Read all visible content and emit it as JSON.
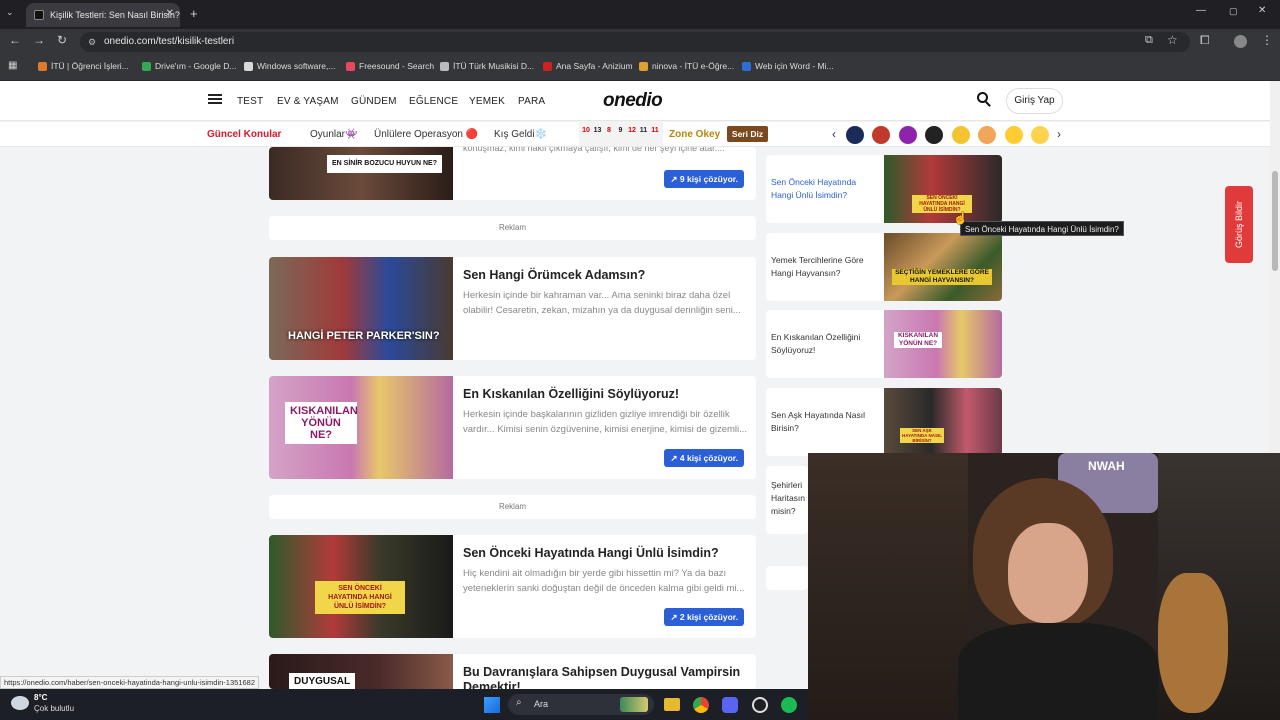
{
  "browser": {
    "tab_title": "Kişilik Testleri: Sen Nasıl Birisin?",
    "tab_close": "✕",
    "new_tab": "+",
    "url": "onedio.com/test/kisilik-testleri",
    "bookmarks": [
      {
        "label": "İTÜ | Öğrenci İşleri...",
        "color": "#e07a2a"
      },
      {
        "label": "Drive'ım - Google D...",
        "color": "#34a853"
      },
      {
        "label": "Windows software,...",
        "color": "#d9d9d9"
      },
      {
        "label": "Freesound - Search",
        "color": "#e8475f"
      },
      {
        "label": "İTÜ Türk Musikisi D...",
        "color": "#bbbbbb"
      },
      {
        "label": "Ana Sayfa - Anizium",
        "color": "#cc2222"
      },
      {
        "label": "ninova - İTÜ e-Öğre...",
        "color": "#e0a030"
      },
      {
        "label": "Web için Word - Mi...",
        "color": "#2b6fd6"
      }
    ]
  },
  "header": {
    "nav": [
      "TEST",
      "EV & YAŞAM",
      "GÜNDEM",
      "EĞLENCE",
      "YEMEK",
      "PARA"
    ],
    "logo": "onedio",
    "login": "Giriş Yap"
  },
  "subnav": {
    "current": "Güncel Konular",
    "items": [
      "Oyunlar👾",
      "Ünlülere Operasyon 🔴",
      "Kış Geldi❄️"
    ],
    "calendar": [
      "10",
      "13",
      "8",
      "9",
      "12",
      "11",
      "11"
    ],
    "zone": "Zone Okey",
    "serial": "Seri Diz"
  },
  "main": {
    "top_partial": {
      "desc": "konuşmaz, kimi haklı çıkmaya çalışır, kimi de her şeyi içine atar....",
      "solve": "9 kişi çözüyor.",
      "banner": "EN SİNİR BOZUCU HUYUN NE?"
    },
    "ad_label": "Reklam",
    "cards": [
      {
        "title": "Sen Hangi Örümcek Adamsın?",
        "desc": "Herkesin içinde bir kahraman var... Ama seninki biraz daha özel olabilir! Cesaretin, zekan, mizahın ya da duygusal derinliğin seni...",
        "banner": "HANGİ PETER PARKER'SIN?"
      },
      {
        "title": "En Kıskanılan Özelliğini Söylüyoruz!",
        "desc": "Herkesin içinde başkalarının gizliden gizliye imrendiği bir özellik vardır... Kimisi senin özgüvenine, kimisi enerjine, kimisi de gizemli...",
        "solve": "4 kişi çözüyor.",
        "banner": "KISKANILAN YÖNÜN NE?"
      },
      {
        "title": "Sen Önceki Hayatında Hangi Ünlü İsimdin?",
        "desc": "Hiç kendini ait olmadığın bir yerde gibi hissettin mi? Ya da bazı yeteneklerin sanki doğuştan değil de önceden kalma gibi geldi mi...",
        "solve": "2 kişi çözüyor.",
        "banner": "SEN ÖNCEKİ HAYATINDA HANGİ ÜNLÜ İSİMDİN?"
      },
      {
        "title": "Bu Davranışlara Sahipsen Duygusal Vampirsin Demektir!",
        "banner": "DUYGUSAL"
      }
    ]
  },
  "sidebar": {
    "items": [
      {
        "title": "Sen Önceki Hayatında Hangi Ünlü İsimdin?",
        "banner": "SEN ÖNCEKİ HAYATINDA HANGİ ÜNLÜ İSİMDİN?"
      },
      {
        "title": "Yemek Tercihlerine Göre Hangi Hayvansın?",
        "banner": "SEÇTİĞİN YEMEKLERE GÖRE HANGİ HAYVANSIN?"
      },
      {
        "title": "En Kıskanılan Özelliğini Söylüyoruz!",
        "banner": "KISKANILAN YÖNÜN NE?"
      },
      {
        "title": "Sen Aşk Hayatında Nasıl Birisin?",
        "banner": "SEN AŞK HAYATINDA NASIL BİRİSİN?"
      },
      {
        "title": "Şehirleri Haritasın misin?"
      }
    ],
    "tooltip": "Sen Önceki Hayatında Hangi Ünlü İsimdin?"
  },
  "feedback": "Görüş Bildir",
  "status_url": "https://onedio.com/haber/sen-onceki-hayatinda-hangi-unlu-isimdin-1351682",
  "taskbar": {
    "temp": "8°C",
    "weather": "Çok bulutlu",
    "search": "Ara"
  },
  "webcam": {
    "sign": "NWAH"
  },
  "colors": {
    "accent": "#2a5fd8",
    "brand_red": "#e03a3a",
    "subnav_red": "#e0162b",
    "zone_gold": "#b8860b"
  }
}
